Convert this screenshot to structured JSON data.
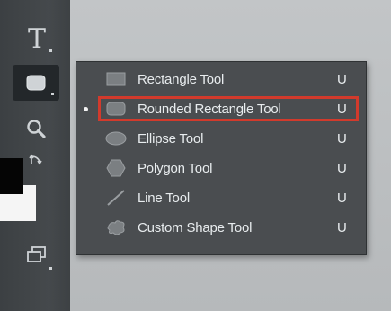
{
  "toolbar": {
    "type_tool_glyph": "T",
    "tools": [
      "horizontal-type-tool",
      "shape-tool",
      "zoom-tool",
      "change-screen-mode"
    ]
  },
  "flyout": {
    "items": [
      {
        "label": "Rectangle Tool",
        "shortcut": "U",
        "icon": "rectangle-icon",
        "selected": false
      },
      {
        "label": "Rounded Rectangle Tool",
        "shortcut": "U",
        "icon": "rounded-rectangle-icon",
        "selected": true
      },
      {
        "label": "Ellipse Tool",
        "shortcut": "U",
        "icon": "ellipse-icon",
        "selected": false
      },
      {
        "label": "Polygon Tool",
        "shortcut": "U",
        "icon": "polygon-icon",
        "selected": false
      },
      {
        "label": "Line Tool",
        "shortcut": "U",
        "icon": "line-icon",
        "selected": false
      },
      {
        "label": "Custom Shape Tool",
        "shortcut": "U",
        "icon": "custom-shape-icon",
        "selected": false
      }
    ]
  },
  "colors": {
    "highlight": "#d23a2c",
    "menu_bg": "#4a4d50",
    "toolbar_bg": "#414548",
    "foreground_swatch": "#050505",
    "background_swatch": "#f5f5f5"
  }
}
